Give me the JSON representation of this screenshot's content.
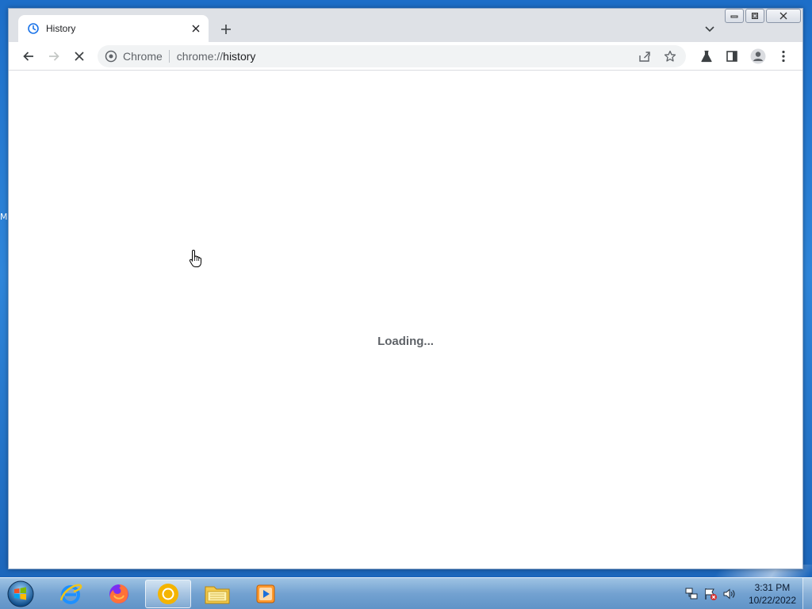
{
  "desktop": {
    "edge_fragment": "M"
  },
  "browser": {
    "tab": {
      "title": "History",
      "favicon": "history-icon"
    },
    "toolbar": {
      "omnibox_chip": "Chrome",
      "url_scheme": "chrome://",
      "url_path": "history"
    },
    "content": {
      "loading_text": "Loading..."
    }
  },
  "taskbar": {
    "apps": [
      "start-orb-icon",
      "internet-explorer-icon",
      "firefox-icon",
      "chrome-icon",
      "file-explorer-icon",
      "media-player-icon"
    ],
    "active_app": "chrome-icon",
    "clock": {
      "time": "3:31 PM",
      "date": "10/22/2022"
    }
  },
  "colors": {
    "tabstrip": "#dee1e6",
    "omnibox": "#f1f3f4",
    "loading_text": "#5f6368",
    "desktop_blue": "#2f86da"
  }
}
